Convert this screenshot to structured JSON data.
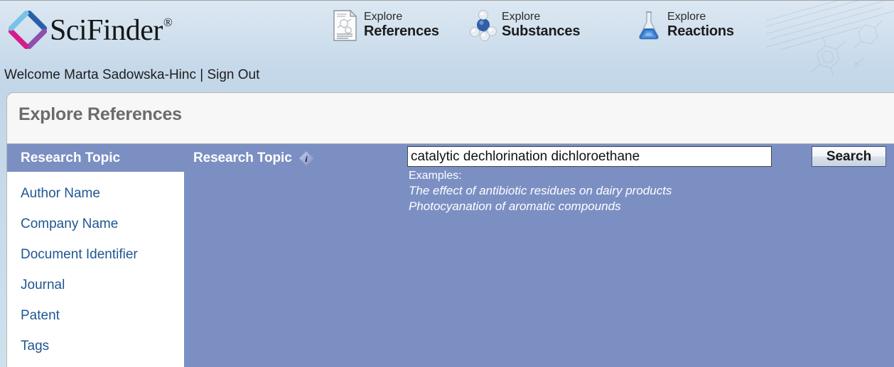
{
  "header": {
    "brand": "SciFinder",
    "brand_registered": "®",
    "logo_icon": "scifinder-diamond-logo",
    "nav": [
      {
        "top": "Explore",
        "bottom": "References",
        "icon": "document-structure-icon"
      },
      {
        "top": "Explore",
        "bottom": "Substances",
        "icon": "molecule-model-icon"
      },
      {
        "top": "Explore",
        "bottom": "Reactions",
        "icon": "flask-icon"
      }
    ],
    "welcome": "Welcome Marta Sadowska-Hinc",
    "separator": "|",
    "sign_out": "Sign Out"
  },
  "panel": {
    "title": "Explore References"
  },
  "sidebar": {
    "selected": "Research Topic",
    "items": [
      {
        "label": "Author Name"
      },
      {
        "label": "Company Name"
      },
      {
        "label": "Document Identifier"
      },
      {
        "label": "Journal"
      },
      {
        "label": "Patent"
      },
      {
        "label": "Tags"
      }
    ]
  },
  "form": {
    "field_label": "Research Topic",
    "info_icon": "info-diamond-icon",
    "input_value": "catalytic dechlorination dichloroethane",
    "input_placeholder": "",
    "examples_heading": "Examples:",
    "examples": [
      "The effect of antibiotic residues on dairy products",
      "Photocyanation of aromatic compounds"
    ],
    "search_label": "Search"
  },
  "colors": {
    "blue_panel": "#7b8fc3",
    "link_blue": "#1f5692",
    "header_blue": "#c6d9ea",
    "panel_title_gray": "#6b6b6b"
  }
}
